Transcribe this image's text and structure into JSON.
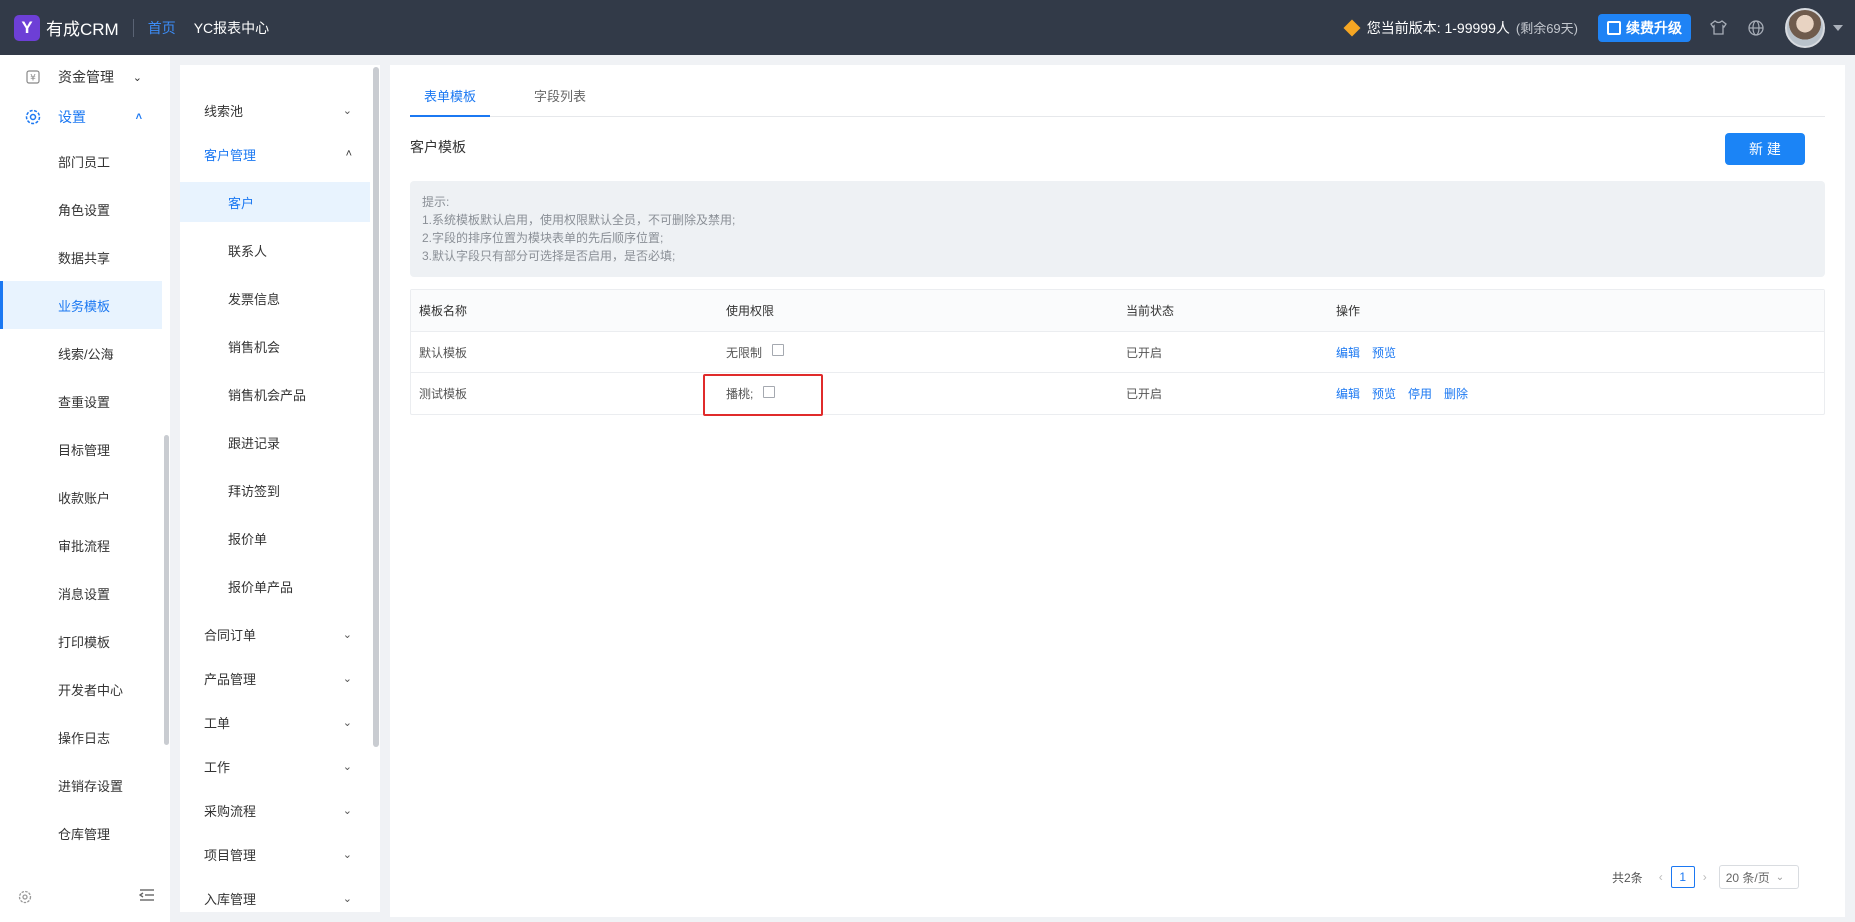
{
  "topbar": {
    "logo_letter": "Y",
    "app_name": "有成CRM",
    "nav": [
      {
        "label": "首页"
      },
      {
        "label": "YC报表中心"
      }
    ],
    "version_text": "您当前版本: 1-99999人",
    "version_remain": "(剩余69天)",
    "upgrade_label": "续费升级",
    "icons": [
      "tshirt-icon",
      "globe-icon"
    ]
  },
  "sidebar": {
    "parents": [
      {
        "label": "资金管理",
        "icon": "¥"
      },
      {
        "label": "设置",
        "icon": "⚙"
      }
    ],
    "items": [
      {
        "label": "部门员工"
      },
      {
        "label": "角色设置"
      },
      {
        "label": "数据共享"
      },
      {
        "label": "业务模板"
      },
      {
        "label": "线索/公海"
      },
      {
        "label": "查重设置"
      },
      {
        "label": "目标管理"
      },
      {
        "label": "收款账户"
      },
      {
        "label": "审批流程"
      },
      {
        "label": "消息设置"
      },
      {
        "label": "打印模板"
      },
      {
        "label": "开发者中心"
      },
      {
        "label": "操作日志"
      },
      {
        "label": "进销存设置"
      },
      {
        "label": "仓库管理"
      }
    ]
  },
  "subnav": {
    "groups_top": [
      {
        "label": "线索池"
      },
      {
        "label": "客户管理"
      }
    ],
    "items": [
      {
        "label": "客户"
      },
      {
        "label": "联系人"
      },
      {
        "label": "发票信息"
      },
      {
        "label": "销售机会"
      },
      {
        "label": "销售机会产品"
      },
      {
        "label": "跟进记录"
      },
      {
        "label": "拜访签到"
      },
      {
        "label": "报价单"
      },
      {
        "label": "报价单产品"
      }
    ],
    "groups_bottom": [
      {
        "label": "合同订单"
      },
      {
        "label": "产品管理"
      },
      {
        "label": "工单"
      },
      {
        "label": "工作"
      },
      {
        "label": "采购流程"
      },
      {
        "label": "项目管理"
      },
      {
        "label": "入库管理"
      }
    ]
  },
  "main": {
    "tabs": [
      {
        "label": "表单模板"
      },
      {
        "label": "字段列表"
      }
    ],
    "section_title": "客户模板",
    "new_button": "新 建",
    "tips": {
      "title": "提示:",
      "lines": [
        "1.系统模板默认启用，使用权限默认全员，不可删除及禁用;",
        "2.字段的排序位置为模块表单的先后顺序位置;",
        "3.默认字段只有部分可选择是否启用，是否必填;"
      ]
    },
    "table": {
      "headers": [
        "模板名称",
        "使用权限",
        "当前状态",
        "操作"
      ],
      "rows": [
        {
          "name": "默认模板",
          "permission": "无限制",
          "status": "已开启",
          "actions": [
            "编辑",
            "预览"
          ]
        },
        {
          "name": "测试模板",
          "permission": "播桃;",
          "status": "已开启",
          "actions": [
            "编辑",
            "预览",
            "停用",
            "删除"
          ]
        }
      ]
    },
    "pager": {
      "total": "共2条",
      "current_page": "1",
      "page_size": "20 条/页"
    }
  },
  "colors": {
    "topbar_bg": "#323a48",
    "accent": "#1b78f2",
    "highlight_border": "#e02b2b"
  }
}
